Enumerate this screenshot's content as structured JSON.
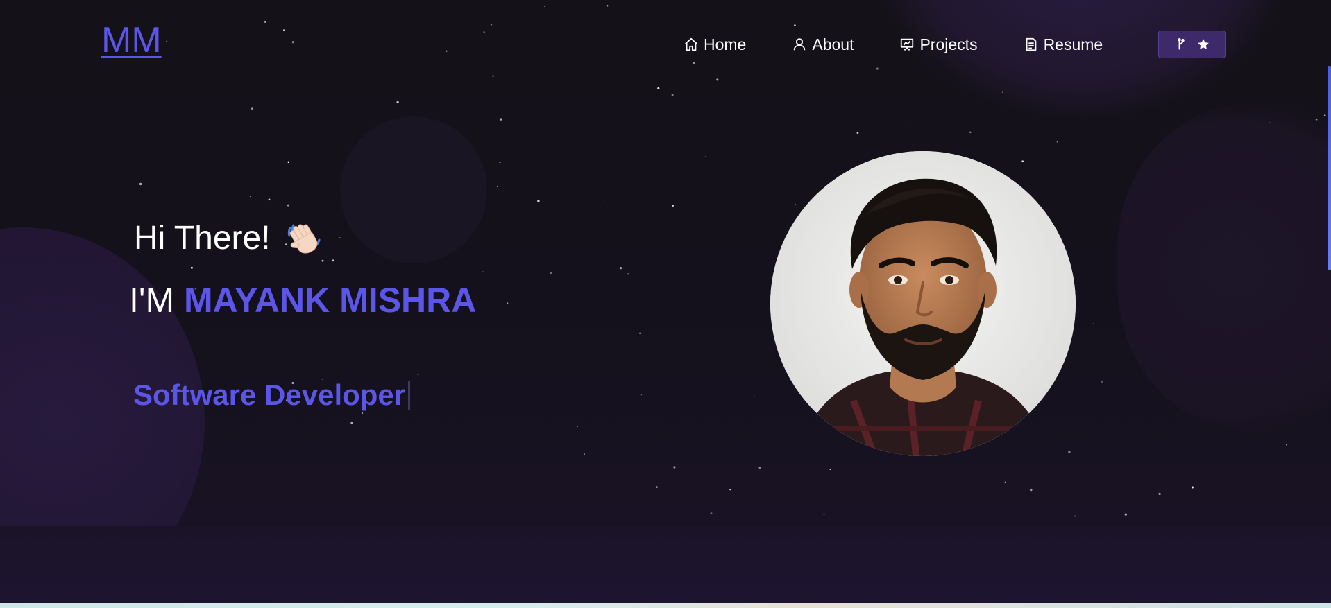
{
  "logo": {
    "text": "MM"
  },
  "nav": {
    "items": [
      {
        "label": "Home",
        "icon": "home-icon"
      },
      {
        "label": "About",
        "icon": "user-icon"
      },
      {
        "label": "Projects",
        "icon": "presentation-chart-icon"
      },
      {
        "label": "Resume",
        "icon": "document-icon"
      }
    ],
    "github_button": {
      "icons": [
        "git-fork-icon",
        "star-icon"
      ]
    }
  },
  "hero": {
    "greeting": "Hi There!",
    "wave_icon": "waving-hand-icon",
    "intro_prefix": "I'M",
    "name": "MAYANK MISHRA",
    "role": "Software Developer"
  },
  "colors": {
    "accent": "#5b56e8",
    "background": "#141118",
    "button": "#3e2a6b"
  }
}
